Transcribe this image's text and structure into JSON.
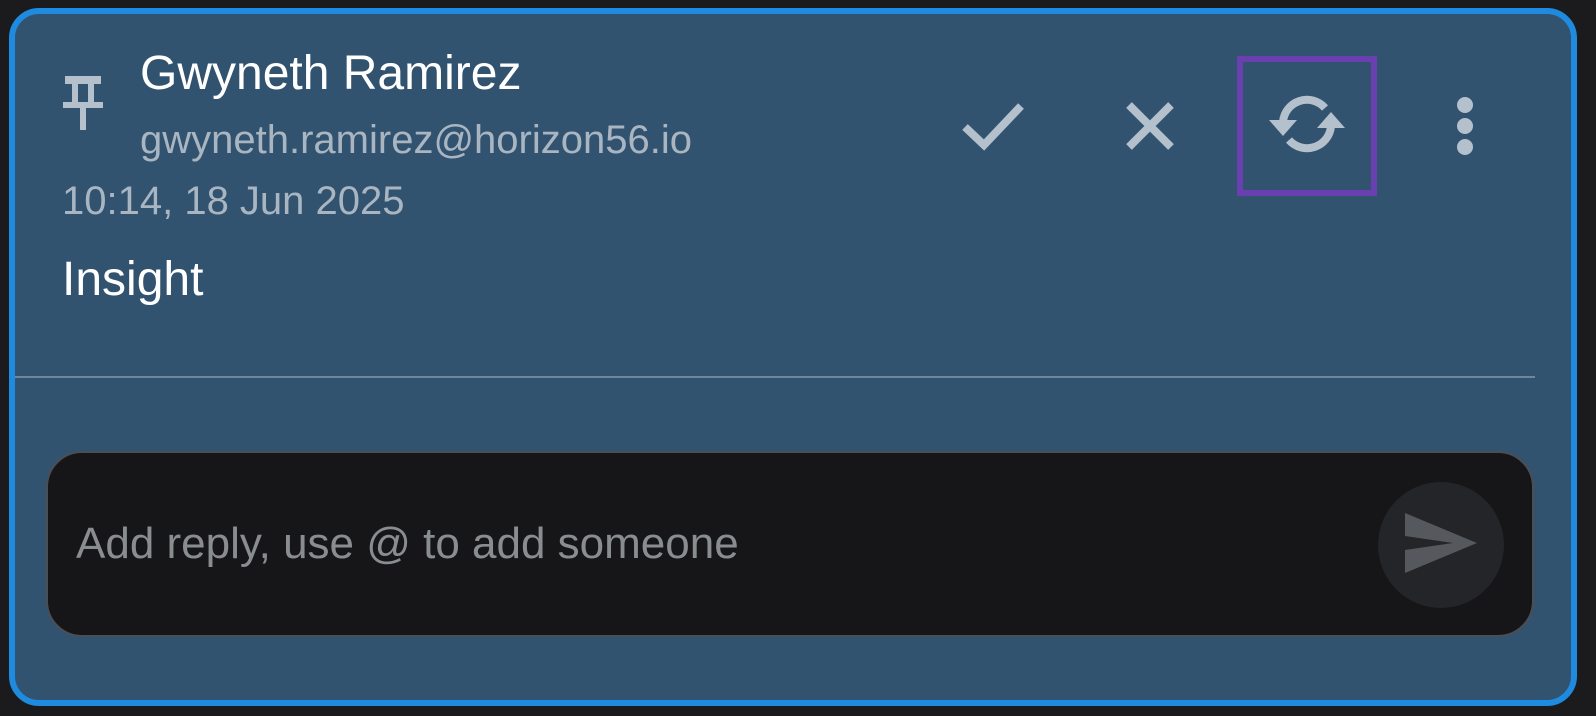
{
  "comment": {
    "author_name": "Gwyneth Ramirez",
    "author_email": "gwyneth.ramirez@horizon56.io",
    "timestamp": "10:14, 18 Jun 2025",
    "text": "Insight",
    "pinned_icon": "pin-icon"
  },
  "actions": [
    {
      "name": "resolve",
      "icon": "check-icon"
    },
    {
      "name": "reject",
      "icon": "close-icon"
    },
    {
      "name": "reopen",
      "icon": "sync-icon",
      "highlighted": true
    },
    {
      "name": "more",
      "icon": "more-vertical-icon"
    }
  ],
  "reply": {
    "placeholder": "Add reply, use @ to add someone",
    "value": "",
    "send_icon": "send-icon"
  },
  "colors": {
    "card_background": "#31536f",
    "card_border": "#1e8be0",
    "highlight_border": "#6a3fb0",
    "icon_color": "#b4c0cb"
  }
}
